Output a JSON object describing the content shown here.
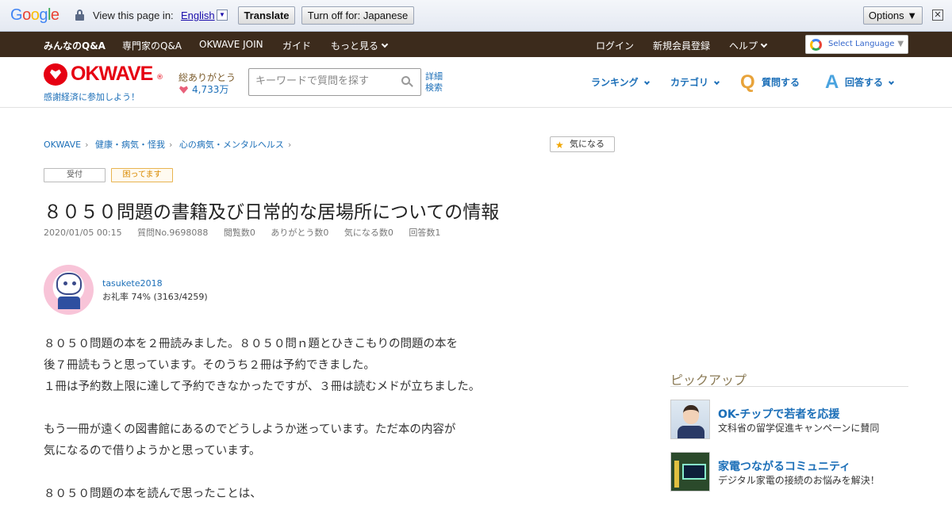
{
  "translate_bar": {
    "logo": "Google",
    "view_text": "View this page in:",
    "language": "English",
    "translate_label": "Translate",
    "turnoff_label": "Turn off for: Japanese",
    "options_label": "Options ▼",
    "close_glyph": "✕"
  },
  "topnav": {
    "items": [
      "みんなのQ&A",
      "専門家のQ&A",
      "OKWAVE JOIN",
      "ガイド",
      "もっと見る"
    ],
    "right_items": [
      "ログイン",
      "新規会員登録",
      "ヘルプ"
    ],
    "select_language": "Select Language",
    "select_language_arrow": "▼"
  },
  "header": {
    "logo_text": "OKWAVE",
    "logo_reg": "®",
    "tagline": "感謝経済に参加しよう！",
    "thanks_label": "総ありがとう",
    "thanks_count": "4,733万",
    "search_placeholder": "キーワードで質問を探す",
    "advanced_search": "詳細検索",
    "nav": [
      "ランキング",
      "カテゴリ"
    ],
    "ask_letter": "Q",
    "ask_label": "質問する",
    "answer_letter": "A",
    "answer_label": "回答する"
  },
  "breadcrumb": [
    "OKWAVE",
    "健康・病気・怪我",
    "心の病気・メンタルヘルス"
  ],
  "breadcrumb_sep": "›",
  "kininaru_label": "気になる",
  "badges": {
    "received": "受付",
    "trouble": "困ってます"
  },
  "question": {
    "title": "８０５０問題の書籍及び日常的な居場所についての情報",
    "date": "2020/01/05 00:15",
    "number": "質問No.9698088",
    "views": "閲覧数0",
    "thanks": "ありがとう数0",
    "kininaru": "気になる数0",
    "answers": "回答数1"
  },
  "user": {
    "name": "tasukete2018",
    "rate": "お礼率 74%  (3163/4259)"
  },
  "body": {
    "p1": [
      "８０５０問題の本を２冊読みました。８０５０問ｎ題とひきこもりの問題の本を",
      "後７冊読もうと思っています。そのうち２冊は予約できました。",
      "１冊は予約数上限に達して予約できなかったですが、３冊は読むメドが立ちました。"
    ],
    "p2": [
      "もう一冊が遠くの図書館にあるのでどうしようか迷っています。ただ本の内容が",
      "気になるので借りようかと思っています。"
    ],
    "p3": [
      "８０５０問題の本を読んで思ったことは、"
    ]
  },
  "sidebar": {
    "pickup_title": "ピックアップ",
    "items": [
      {
        "title": "OK-チップで若者を応援",
        "sub": "文科省の留学促進キャンペーンに賛同"
      },
      {
        "title": "家電つながるコミュニティ",
        "sub": "デジタル家電の接続のお悩みを解決！"
      }
    ]
  },
  "colors": {
    "brand_red": "#e60012",
    "nav_dark": "#3c2b1c",
    "link_blue": "#1c6fb8"
  }
}
